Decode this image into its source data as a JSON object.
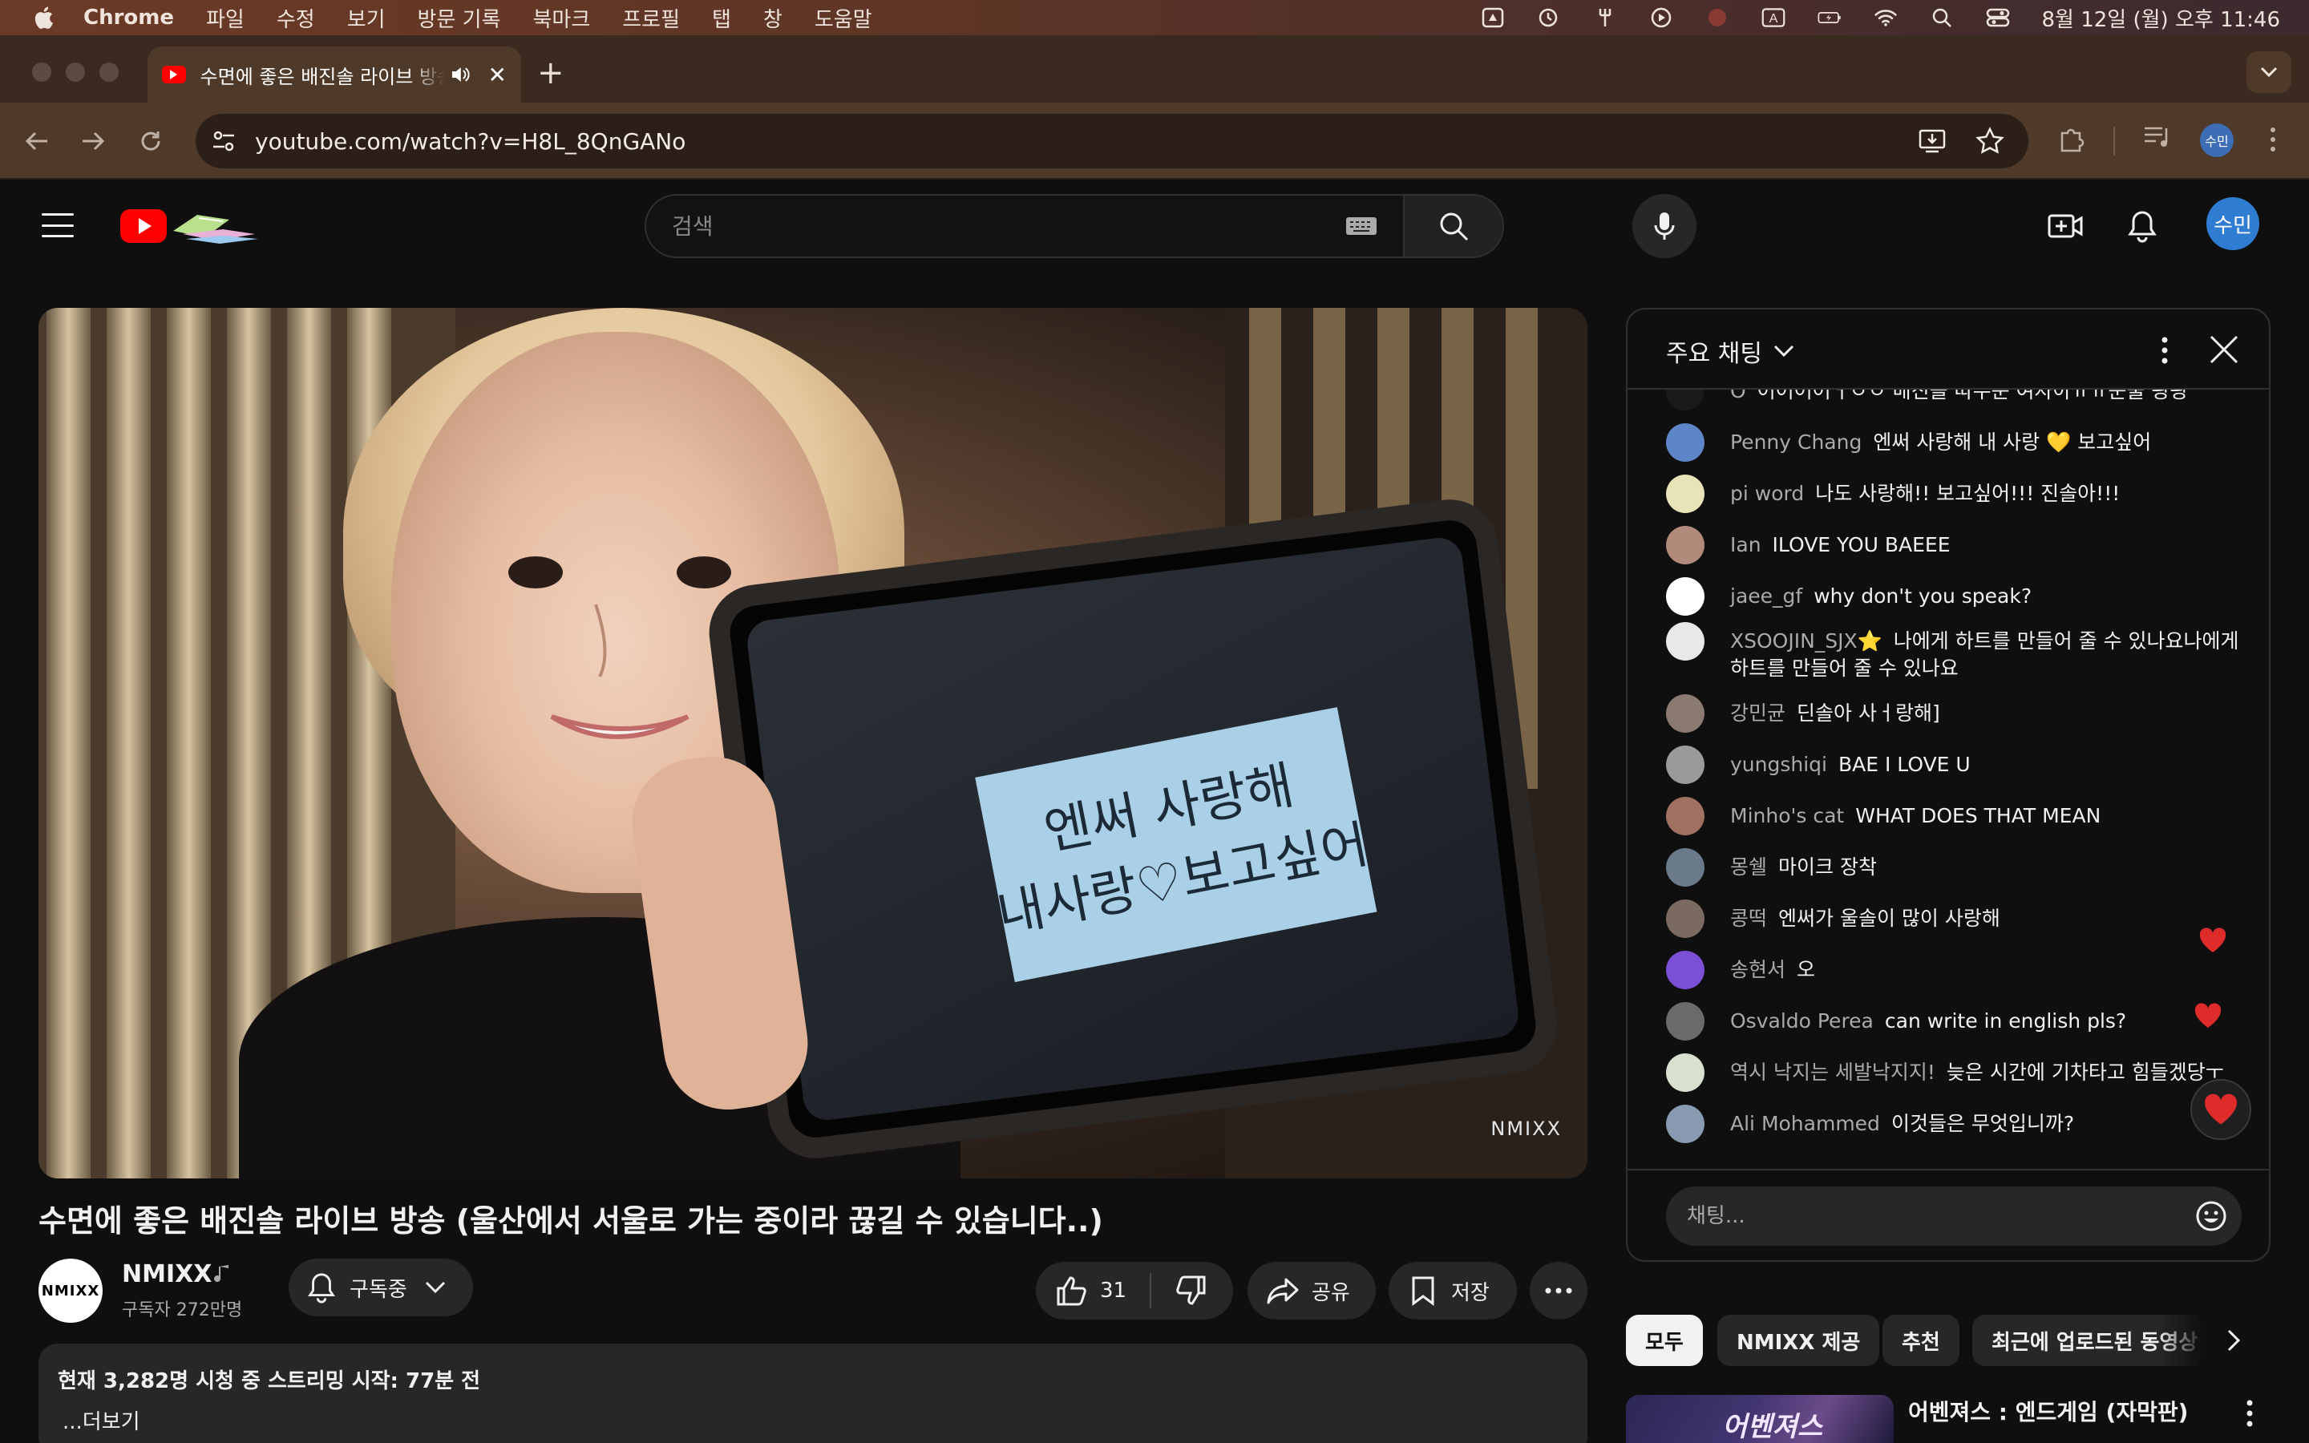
{
  "menubar": {
    "app_name": "Chrome",
    "items": [
      "파일",
      "수정",
      "보기",
      "방문 기록",
      "북마크",
      "프로필",
      "탭",
      "창",
      "도움말"
    ],
    "clock": "8월 12일 (월) 오후 11:46",
    "status_icons": [
      "drive-icon",
      "time-machine-icon",
      "fork-icon",
      "play-icon",
      "record-icon",
      "input-source-icon",
      "battery-icon",
      "wifi-icon",
      "spotlight-icon",
      "control-center-icon"
    ],
    "input_source": "A"
  },
  "browser": {
    "tab_title": "수면에 좋은 배진솔 라이브 방송",
    "tab_close": "✕",
    "new_tab": "+",
    "url": "youtube.com/watch?v=H8L_8QnGANo",
    "profile_label": "수민"
  },
  "youtube": {
    "search_placeholder": "검색",
    "avatar_label": "수민"
  },
  "video": {
    "title": "수면에 좋은 배진솔 라이브 방송 (울산에서 서울로 가는 중이라 끊길 수 있습니다..)",
    "note_line1": "엔써 사랑해",
    "note_line2": "내사랑♡보고싶어",
    "watermark": "NMIXX",
    "channel_avatar_text": "NMIXX",
    "channel_name": "NMIXX",
    "subscribers": "구독자 272만명",
    "subscribe_label": "구독중",
    "like_count": "31",
    "share_label": "공유",
    "save_label": "저장",
    "description_stats": "현재 3,282명 시청 중  스트리밍 시작: 77분 전",
    "description_more": "...더보기"
  },
  "chat": {
    "title": "주요 채팅",
    "input_placeholder": "채팅...",
    "messages": [
      {
        "author": "O",
        "text": "어어어어ㅓㅇㅇ 배진솔 따수운 여자아ㅠㅠ눈물 광광",
        "avatar_color": "#1a1a1a"
      },
      {
        "author": "Penny Chang",
        "text": "엔써 사랑해 내 사랑 💛 보고싶어",
        "avatar_color": "#5c86c8"
      },
      {
        "author": "pi word",
        "text": "나도 사랑해!! 보고싶어!!! 진솔아!!!",
        "avatar_color": "#e9e3b8"
      },
      {
        "author": "Ian",
        "text": "ILOVE YOU BAEEE",
        "avatar_color": "#b08a7a"
      },
      {
        "author": "jaee_gf",
        "text": "why don't you speak?",
        "avatar_color": "#ffffff"
      },
      {
        "author": "XSOOJIN_SJX⭐",
        "text": "나에게 하트를 만들어 줄 수 있나요나에게 하트를 만들어 줄 수 있나요",
        "avatar_color": "#e8e8e8"
      },
      {
        "author": "강민균",
        "text": "딘솔아 사ㅓ랑해]",
        "avatar_color": "#8a7a70"
      },
      {
        "author": "yungshiqi",
        "text": "BAE I LOVE U",
        "avatar_color": "#9a9a9a"
      },
      {
        "author": "Minho's cat",
        "text": "WHAT DOES THAT MEAN",
        "avatar_color": "#a07060"
      },
      {
        "author": "몽쉘",
        "text": "마이크 장착",
        "avatar_color": "#6a7a8a"
      },
      {
        "author": "콩떡",
        "text": "엔써가 울솔이 많이 사랑해",
        "avatar_color": "#7a6a60"
      },
      {
        "author": "송현서",
        "text": "오",
        "avatar_color": "#7b4fd6"
      },
      {
        "author": "Osvaldo Perea",
        "text": "can write in english pls?",
        "avatar_color": "#6a6a6a"
      },
      {
        "author": "역시 낙지는 세발낙지지!",
        "text": "늦은 시간에 기차타고 힘들겠당ㅜ",
        "avatar_color": "#d8e0d0"
      },
      {
        "author": "Ali Mohammed",
        "text": "이것들은 무엇입니까?",
        "avatar_color": "#8a9ab0"
      }
    ]
  },
  "chips": [
    "모두",
    "NMIXX 제공",
    "추천",
    "최근에 업로드된 동영상"
  ],
  "recommendation": {
    "title": "어벤져스 : 엔드게임 (자막판)",
    "thumb_label": "어벤져스"
  },
  "colors": {
    "youtube_red": "#ff0000",
    "background": "#0f0f0f",
    "surface": "#272727",
    "heart": "#e02b2b"
  }
}
